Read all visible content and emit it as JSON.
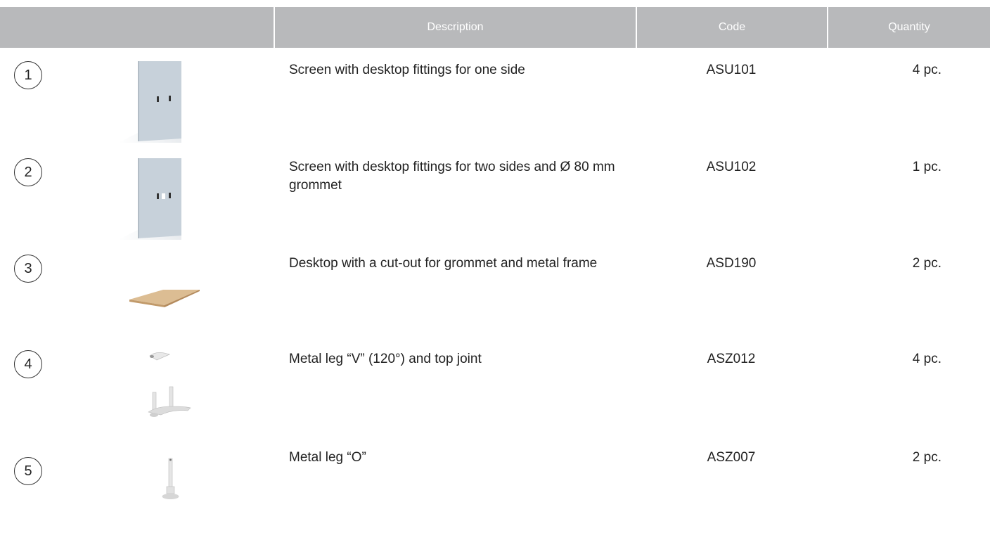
{
  "header": {
    "col_image": "",
    "col_description": "Description",
    "col_code": "Code",
    "col_quantity": "Quantity"
  },
  "items": [
    {
      "number": "1",
      "description": "Screen with desktop fittings for one side",
      "code": "ASU101",
      "quantity": "4 pc.",
      "icon": "screen-panel-icon"
    },
    {
      "number": "2",
      "description": "Screen with desktop fittings for two sides and Ø 80 mm grommet",
      "code": "ASU102",
      "quantity": "1 pc.",
      "icon": "screen-panel-grommet-icon"
    },
    {
      "number": "3",
      "description": "Desktop with a cut-out for grommet and metal frame",
      "code": "ASD190",
      "quantity": "2 pc.",
      "icon": "desktop-board-icon"
    },
    {
      "number": "4",
      "description": "Metal leg “V” (120°) and top joint",
      "code": "ASZ012",
      "quantity": "4 pc.",
      "icon": "metal-leg-v-icon"
    },
    {
      "number": "5",
      "description": "Metal leg “O”",
      "code": "ASZ007",
      "quantity": "2 pc.",
      "icon": "metal-leg-o-icon"
    }
  ],
  "colors": {
    "header_bg": "#b8b9bb",
    "screen_panel": "#c9d3dc",
    "desktop_wood": "#d9b98c",
    "metal_leg": "#e6e6e6"
  }
}
